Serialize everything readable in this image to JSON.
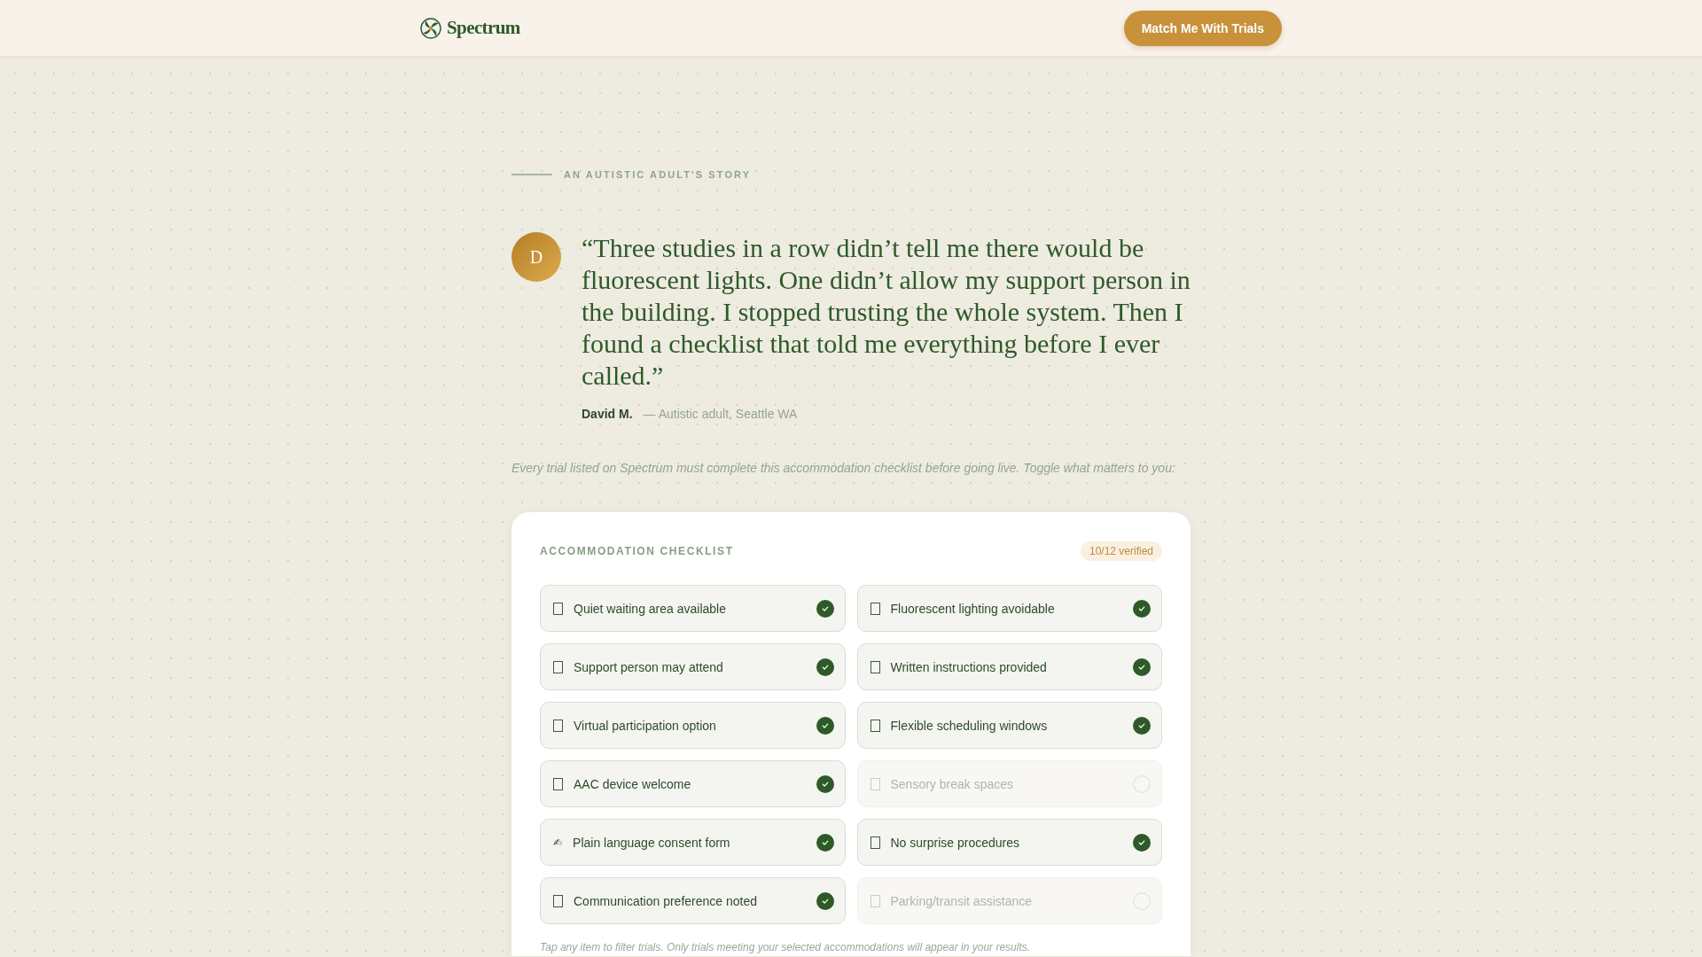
{
  "header": {
    "brand": "Spectrum",
    "cta": "Match Me With Trials"
  },
  "story": {
    "eyebrow": "AN AUTISTIC ADULT'S STORY",
    "avatar_initial": "D",
    "quote": "“Three studies in a row didn’t tell me there would be fluorescent lights. One didn’t allow my support person in the building. I stopped trusting the whole system. Then I found a checklist that told me everything before I ever called.”",
    "author": "David M.",
    "author_detail": "— Autistic adult, Seattle WA"
  },
  "intro": "Every trial listed on Spectrum must complete this accommodation checklist before going live. Toggle what matters to you:",
  "checklist": {
    "title": "ACCOMMODATION CHECKLIST",
    "badge": "10/12 verified",
    "items": [
      {
        "label": "Quiet waiting area available",
        "checked": true
      },
      {
        "label": "Fluorescent lighting avoidable",
        "checked": true
      },
      {
        "label": "Support person may attend",
        "checked": true
      },
      {
        "label": "Written instructions provided",
        "checked": true
      },
      {
        "label": "Virtual participation option",
        "checked": true
      },
      {
        "label": "Flexible scheduling windows",
        "checked": true
      },
      {
        "label": "AAC device welcome",
        "checked": true
      },
      {
        "label": "Sensory break spaces",
        "checked": false
      },
      {
        "label": "Plain language consent form",
        "checked": true,
        "glyph": "✍"
      },
      {
        "label": "No surprise procedures",
        "checked": true
      },
      {
        "label": "Communication preference noted",
        "checked": true
      },
      {
        "label": "Parking/transit assistance",
        "checked": false
      }
    ],
    "note": "Tap any item to filter trials. Only trials meeting your selected accommodations will appear in your results."
  }
}
